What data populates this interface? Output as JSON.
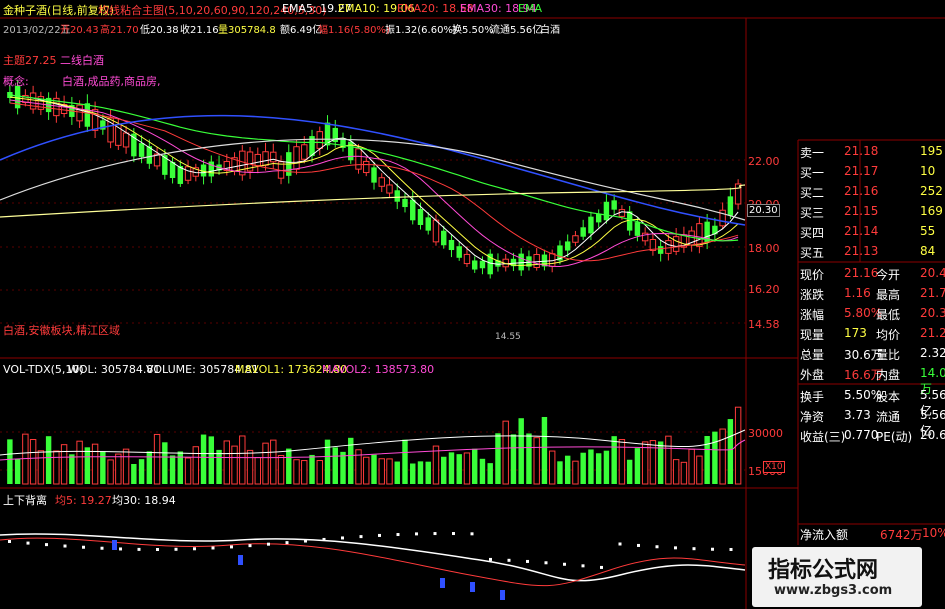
{
  "header": {
    "title": "金种子酒(日线,前复权)",
    "indicator": "均线粘合主图(5,10,20,60,90,120,240,5,30)",
    "ema5": "EMA5: 19.27",
    "ema10": "EMA10: 19.06",
    "ema20": "EMA20: 18.58",
    "ema30": "EMA30: 18.94",
    "ema_more": "EMA",
    "row2_date": "2013/02/22五",
    "row2_open": "开20.43",
    "row2_high": "高21.70",
    "row2_low": "低20.38",
    "row2_close": "收21.16",
    "row2_vol": "量305784.8",
    "row2_amt": "额6.49亿",
    "row2_amp": "幅1.16(5.80%)",
    "row2_zhen": "振1.32(6.60%)",
    "row2_turn": "换5.50%",
    "row2_float": "流通5.56亿",
    "row2_sector": "白酒",
    "row3_a": "主题27.25",
    "row3_b": "二线白酒",
    "row4_a": "概念:",
    "row4_b": "白酒,成品药,商品房,",
    "bottom_note": "白酒,安徽板块,精江区域",
    "low_mark": "14.55"
  },
  "price_axis": [
    "22.00",
    "20.00",
    "18.00",
    "16.20",
    "14.58"
  ],
  "price_tag": "20.30",
  "volume": {
    "header_name": "VOL-TDX(5,10)",
    "vol_value": "WOL: 305784.81",
    "volume_value": "VOLUME: 305784.81",
    "mavol1": "MAVOL1: 173624.80",
    "mavol2": "MAVOL2: 138573.80",
    "axis": [
      "30000",
      "15000"
    ],
    "unit": "X10"
  },
  "lower": {
    "name": "上下背离",
    "avg5": "均5: 19.27",
    "avg30": "均30: 18.94"
  },
  "quote_panel": {
    "rows": [
      {
        "label": "卖一",
        "price": "21.18",
        "vol": "195"
      },
      {
        "label": "买一",
        "price": "21.17",
        "vol": "10"
      },
      {
        "label": "买二",
        "price": "21.16",
        "vol": "252"
      },
      {
        "label": "买三",
        "price": "21.15",
        "vol": "169"
      },
      {
        "label": "买四",
        "price": "21.14",
        "vol": "55"
      },
      {
        "label": "买五",
        "price": "21.13",
        "vol": "84"
      }
    ],
    "stats": [
      {
        "l1": "现价",
        "v1": "21.16",
        "l2": "今开",
        "v2": "20.43"
      },
      {
        "l1": "涨跌",
        "v1": "1.16",
        "l2": "最高",
        "v2": "21.70"
      },
      {
        "l1": "涨幅",
        "v1": "5.80%",
        "l2": "最低",
        "v2": "20.38"
      },
      {
        "l1": "现量",
        "v1": "173",
        "l2": "均价",
        "v2": "21.24"
      },
      {
        "l1": "总量",
        "v1": "30.6万",
        "l2": "量比",
        "v2": "2.32"
      },
      {
        "l1": "外盘",
        "v1": "16.6万",
        "l2": "内盘",
        "v2": "14.0万"
      }
    ],
    "stats2": [
      {
        "l1": "换手",
        "v1": "5.50%",
        "l2": "股本",
        "v2": "5.56亿"
      },
      {
        "l1": "净资",
        "v1": "3.73",
        "l2": "流通",
        "v2": "5.56亿"
      },
      {
        "l1": "收益(三)",
        "v1": "0.770",
        "l2": "PE(动)",
        "v2": "20.6"
      }
    ],
    "netflow_label": "净流入额",
    "netflow_value": "6742万",
    "netflow_pct": "10%"
  },
  "watermark": {
    "title": "指标公式网",
    "url": "www.zbgs3.com"
  }
}
